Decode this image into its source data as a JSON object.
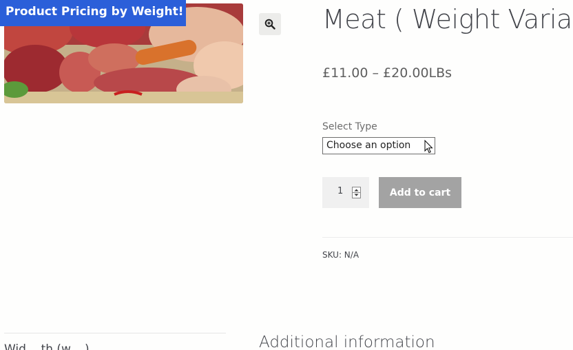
{
  "banner": {
    "text": "Product Pricing by Weight!",
    "color": "#2b5fd9"
  },
  "product": {
    "title": "Meat ( Weight Variable)",
    "price_range": "£11.00 – £20.00LBs",
    "image_alt": "Assorted raw meats"
  },
  "zoom": {
    "icon": "zoom-in-icon"
  },
  "variation": {
    "label": "Select Type",
    "selected": "Choose an option"
  },
  "quantity": {
    "value": "1"
  },
  "add_to_cart": {
    "label": "Add to cart",
    "color": "#a3a3a3"
  },
  "meta": {
    "sku": "SKU: N/A"
  },
  "tabs": {
    "left_partial": "Wid... th (w... )",
    "additional_info": "Additional information"
  }
}
